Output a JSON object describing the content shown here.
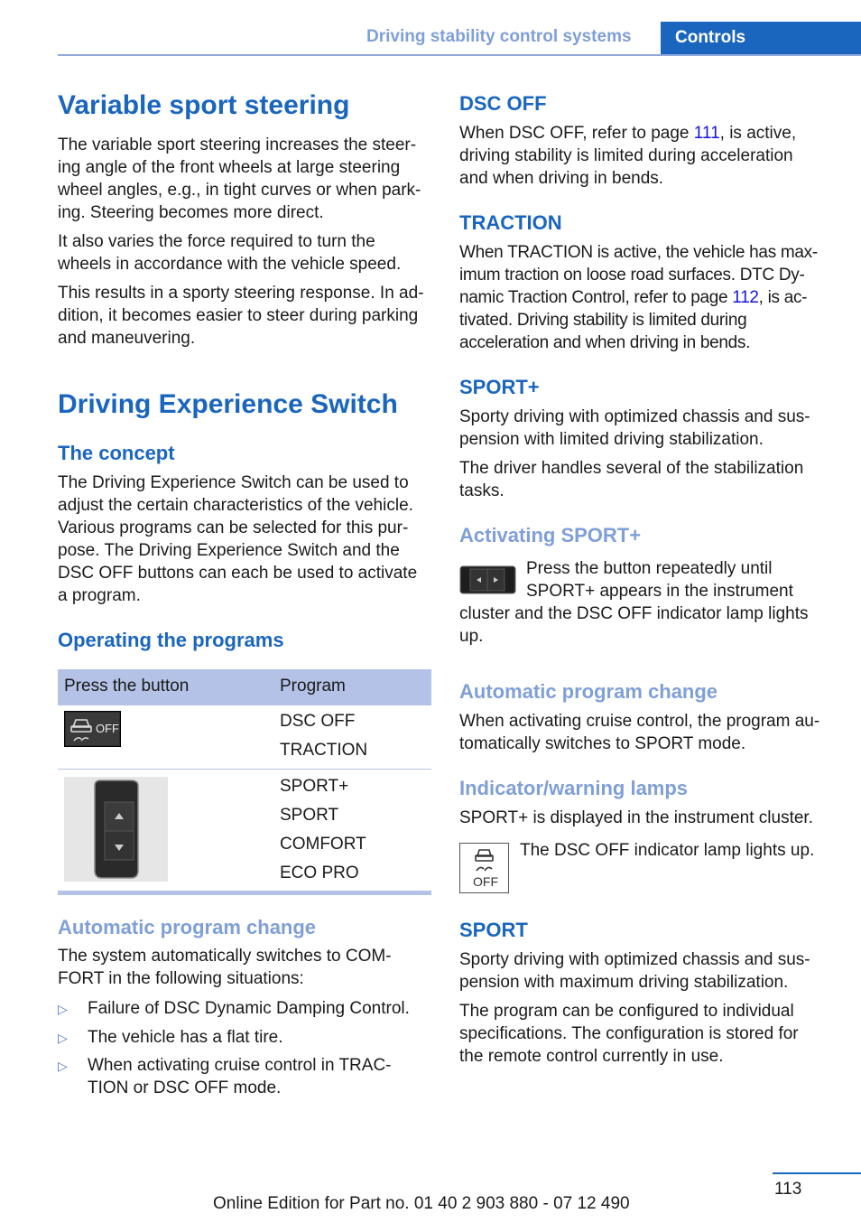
{
  "header": {
    "section": "Driving stability control systems",
    "tab": "Controls"
  },
  "left": {
    "title1": "Variable sport steering",
    "vss_p1": [
      "The variable sport steering increases the steer-",
      "ing angle of the front wheels at large steering",
      "wheel angles, e.g., in tight curves or when park-",
      "ing. Steering becomes more direct."
    ],
    "vss_p2": [
      "It also varies the force required to turn the",
      "wheels in accordance with the vehicle speed."
    ],
    "vss_p3": [
      "This results in a sporty steering response. In ad-",
      "dition, it becomes easier to steer during parking",
      "and maneuvering."
    ],
    "title2": "Driving Experience Switch",
    "concept_heading": "The concept",
    "concept_p": [
      "The Driving Experience Switch can be used to",
      "adjust the certain characteristics of the vehicle.",
      "Various programs can be selected for this pur-",
      "pose. The Driving Experience Switch and the",
      "DSC OFF buttons can each be used to activate",
      "a program."
    ],
    "operating_heading": "Operating the programs",
    "table": {
      "headers": [
        "Press the button",
        "Program"
      ],
      "rows": [
        {
          "button_icon": "dsc-off-button",
          "button_label": "OFF",
          "programs": [
            "DSC OFF",
            "TRACTION"
          ]
        },
        {
          "button_icon": "driving-experience-switch",
          "programs": [
            "SPORT+",
            "SPORT",
            "COMFORT",
            "ECO PRO"
          ]
        }
      ]
    },
    "auto_heading": "Automatic program change",
    "auto_p": [
      "The system automatically switches to COM-",
      "FORT in the following situations:"
    ],
    "bullets": [
      [
        "Failure of DSC Dynamic Damping Control."
      ],
      [
        "The vehicle has a flat tire."
      ],
      [
        "When activating cruise control in TRAC-",
        "TION or DSC OFF mode."
      ]
    ],
    "bullet_glyph": "▷"
  },
  "right": {
    "dsc_heading": "DSC OFF",
    "dsc_p": {
      "a": "When DSC OFF, refer to page ",
      "link": "111",
      "b": ", is active,",
      "l2": "driving stability is limited during acceleration",
      "l3": "and when driving in bends."
    },
    "traction_heading": "TRACTION",
    "traction_p": {
      "l1": "When TRACTION is active, the vehicle has max-",
      "l2": "imum traction on loose road surfaces. DTC Dy-",
      "l3a": "namic Traction Control, refer to page ",
      "link": "112",
      "l3b": ", is ac-",
      "l4": "tivated. Driving stability is limited during",
      "l5": "acceleration and when driving in bends."
    },
    "sportplus_heading": "SPORT+",
    "sportplus_p1": [
      "Sporty driving with optimized chassis and sus-",
      "pension with limited driving stabilization."
    ],
    "sportplus_p2": [
      "The driver handles several of the stabilization",
      "tasks."
    ],
    "activating_heading": "Activating SPORT+",
    "activating_p": [
      "Press the button repeatedly until",
      "SPORT+ appears in the instrument",
      "cluster and the DSC OFF indicator lamp lights",
      "up."
    ],
    "auto_heading": "Automatic program change",
    "auto_p": [
      "When activating cruise control, the program au-",
      "tomatically switches to SPORT mode."
    ],
    "lamps_heading": "Indicator/warning lamps",
    "lamps_p": "SPORT+ is displayed in the instrument cluster.",
    "lamp_text": "The DSC OFF indicator lamp lights up.",
    "lamp_label": "OFF",
    "sport_heading": "SPORT",
    "sport_p1": [
      "Sporty driving with optimized chassis and sus-",
      "pension with maximum driving stabilization."
    ],
    "sport_p2": [
      "The program can be configured to individual",
      "specifications. The configuration is stored for",
      "the remote control currently in use."
    ]
  },
  "footer": {
    "edition": "Online Edition for Part no. 01 40 2 903 880 - 07 12 490",
    "page_number": "113"
  }
}
